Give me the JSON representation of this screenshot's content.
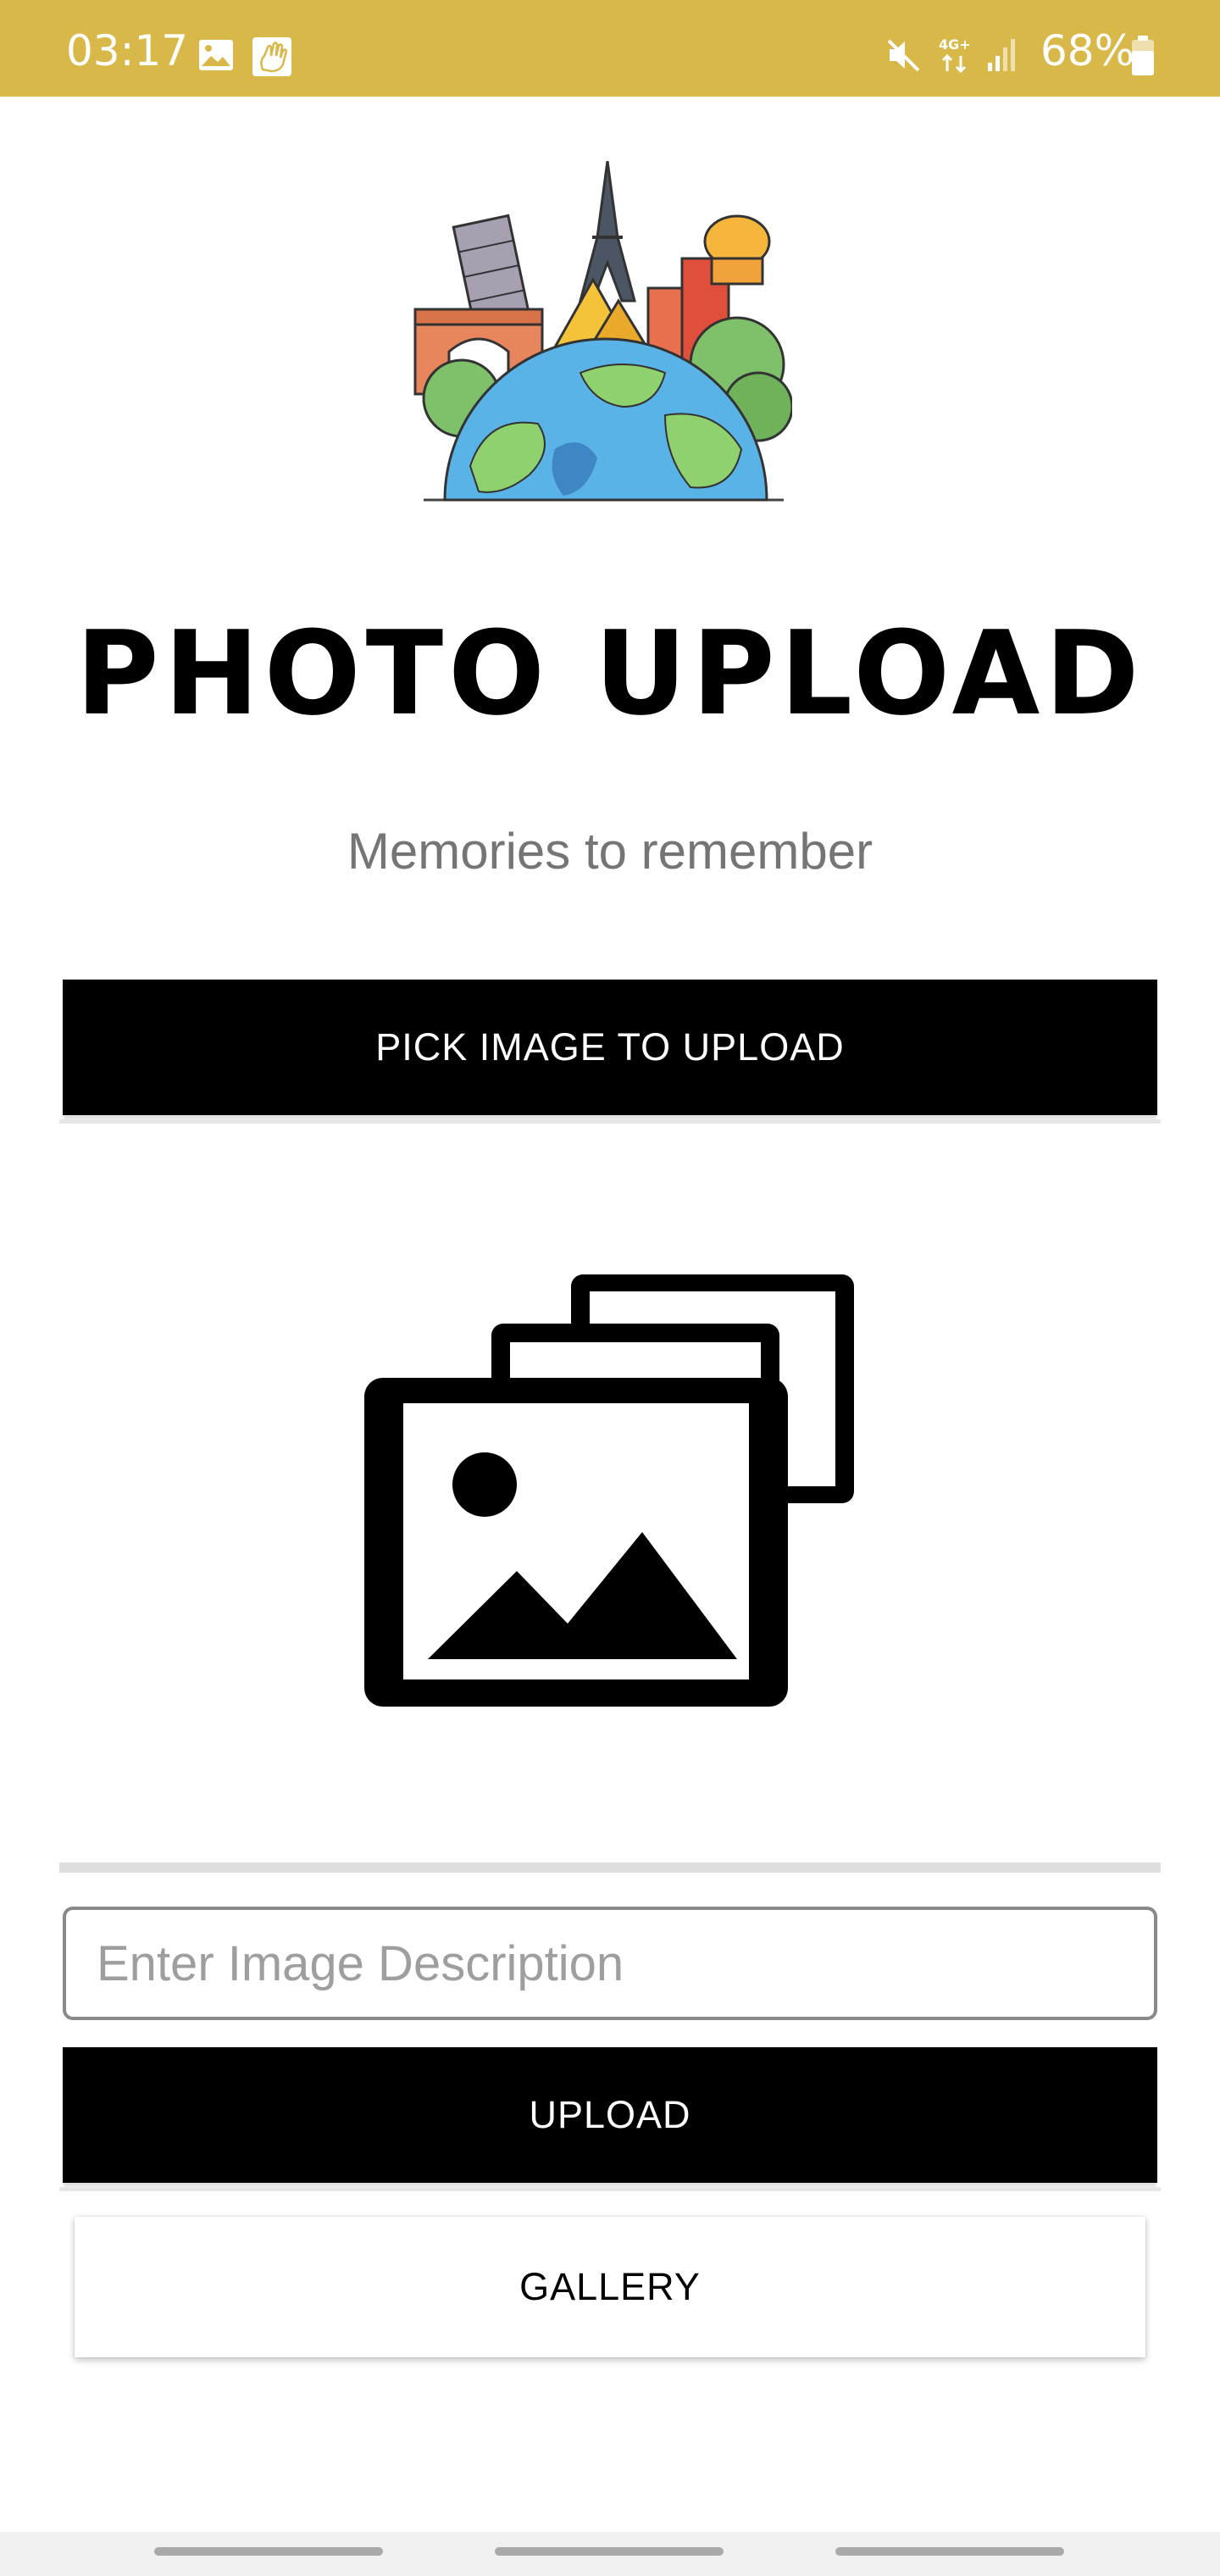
{
  "status_bar": {
    "time": "03:17",
    "battery": "68%",
    "background_color": "#d9b84a",
    "icons": [
      "gallery-notification-icon",
      "hand-notification-icon",
      "mute-icon",
      "4g-data-icon",
      "signal-icon",
      "battery-icon"
    ]
  },
  "header": {
    "logo": "travel-landmarks-globe-logo",
    "title": "PHOTO UPLOAD",
    "subtitle": "Memories to remember"
  },
  "actions": {
    "pick_label": "PICK IMAGE TO UPLOAD",
    "upload_label": "UPLOAD",
    "gallery_label": "GALLERY"
  },
  "preview": {
    "icon": "photo-library-icon"
  },
  "description_input": {
    "placeholder": "Enter Image Description",
    "value": ""
  },
  "nav_bar": {
    "items": [
      "recent-apps",
      "home",
      "back"
    ]
  }
}
